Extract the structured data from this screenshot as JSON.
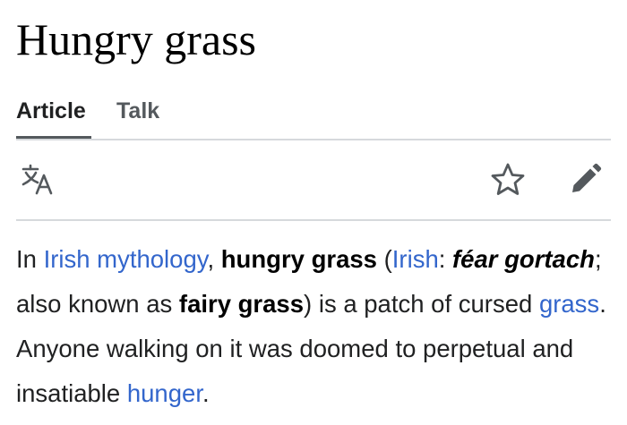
{
  "article": {
    "title": "Hungry grass"
  },
  "tabs": [
    {
      "label": "Article",
      "active": true
    },
    {
      "label": "Talk",
      "active": false
    }
  ],
  "toolbar": {
    "translate_icon": "translate-icon",
    "watch_icon": "star-icon",
    "edit_icon": "pencil-icon"
  },
  "content": {
    "t1": "In ",
    "link_irish_mythology": "Irish mythology",
    "t2": ", ",
    "bold_hungry_grass": "hungry grass",
    "t3": " (",
    "link_irish": "Irish",
    "t4": ": ",
    "bold_italic_fear_gortach": "féar gortach",
    "t5": "; also known as ",
    "bold_fairy_grass": "fairy grass",
    "t6": ") is a patch of cursed ",
    "link_grass": "grass",
    "t7": ". Anyone walking on it was doomed to perpetual and insatiable ",
    "link_hunger": "hunger",
    "t8": "."
  },
  "colors": {
    "link": "#3366cc",
    "text": "#202122",
    "tab_inactive": "#54595d",
    "divider": "#d6d9dc"
  }
}
